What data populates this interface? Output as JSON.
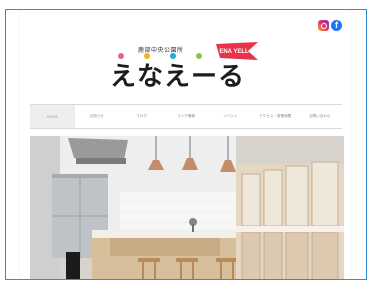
{
  "social": {
    "instagram_icon": "instagram-icon",
    "facebook_icon": "facebook-icon",
    "facebook_glyph": "f"
  },
  "logo": {
    "pre": "鹿部中央公園所",
    "flag": "ENA YELL",
    "wordmark": "えなえーる",
    "dot_colors": [
      "#e95f9e",
      "#f2b21a",
      "#25a8db",
      "#8cc63f"
    ],
    "flag_color": "#e8334a"
  },
  "nav": [
    "HOME",
    "お知らせ",
    "ブログ",
    "ランチ情報",
    "イベント",
    "アクセス・営業時間",
    "お問い合わせ"
  ],
  "hero": {
    "alt": "cafe-kitchen-photo"
  }
}
